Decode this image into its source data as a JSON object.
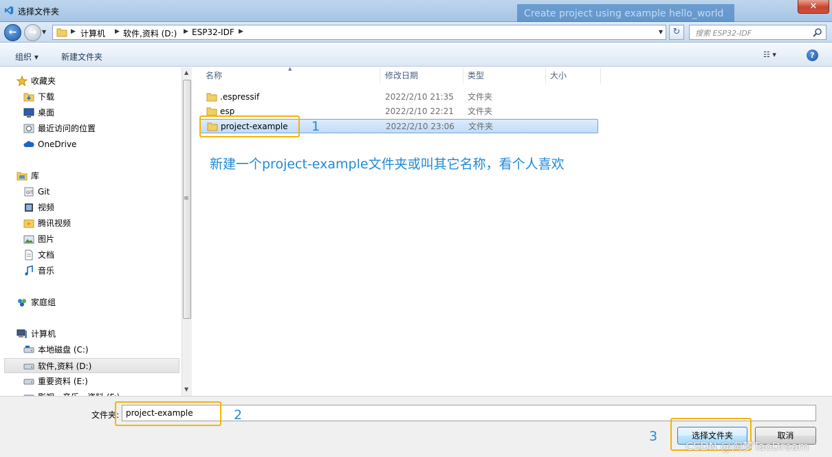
{
  "window": {
    "title": "选择文件夹",
    "close_label": "✕",
    "background_text": "Create project using example hello_world"
  },
  "nav": {
    "back_label": "←",
    "forward_label": "→",
    "breadcrumbs": [
      "计算机",
      "软件,资料 (D:)",
      "ESP32-IDF"
    ],
    "refresh_label": "↻",
    "search_placeholder": "搜索 ESP32-IDF"
  },
  "toolbar": {
    "organize_label": "组织 ▾",
    "new_folder_label": "新建文件夹",
    "view_label": "☷ ▾",
    "help_label": "?"
  },
  "sidebar": {
    "favorites": {
      "label": "收藏夹",
      "items": [
        "下载",
        "桌面",
        "最近访问的位置",
        "OneDrive"
      ]
    },
    "libraries": {
      "label": "库",
      "items": [
        "Git",
        "视频",
        "腾讯视频",
        "图片",
        "文档",
        "音乐"
      ]
    },
    "homegroup": {
      "label": "家庭组"
    },
    "computer": {
      "label": "计算机",
      "items": [
        "本地磁盘 (C:)",
        "软件,资料 (D:)",
        "重要资料 (E:)",
        "影视，音乐，资料 (F:)"
      ]
    }
  },
  "columns": [
    "名称",
    "修改日期",
    "类型",
    "大小"
  ],
  "files": [
    {
      "name": ".espressif",
      "date": "2022/2/10 21:35",
      "type": "文件夹"
    },
    {
      "name": "esp",
      "date": "2022/2/10 22:21",
      "type": "文件夹"
    },
    {
      "name": "project-example",
      "date": "2022/2/10 23:06",
      "type": "文件夹"
    }
  ],
  "annotation": {
    "text": "新建一个project-example文件夹或叫其它名称，看个人喜欢",
    "step1": "1",
    "step2": "2",
    "step3": "3"
  },
  "bottom": {
    "folder_label": "文件夹:",
    "folder_value": "project-example",
    "select_label": "选择文件夹",
    "cancel_label": "取消"
  },
  "watermark": "CSDN @淘梦TaoDream",
  "colors": {
    "accent_annotation": "#1e8ad8",
    "highlight_box": "#f5b400",
    "selection": "#c1dcfb"
  }
}
